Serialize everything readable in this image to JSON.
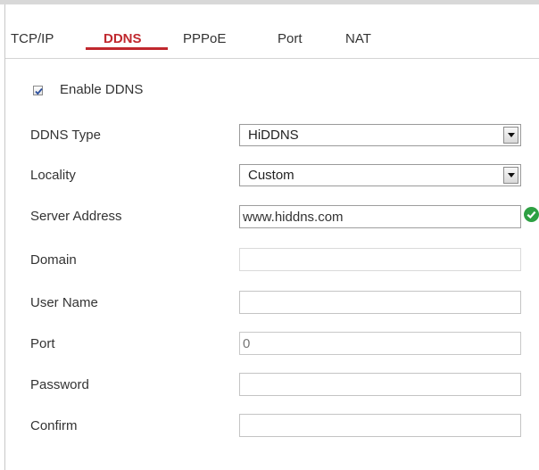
{
  "tabs": [
    {
      "label": "TCP/IP",
      "active": false
    },
    {
      "label": "DDNS",
      "active": true
    },
    {
      "label": "PPPoE",
      "active": false
    },
    {
      "label": "Port",
      "active": false
    },
    {
      "label": "NAT",
      "active": false
    }
  ],
  "enable_ddns": {
    "label": "Enable DDNS",
    "checked": true
  },
  "fields": {
    "ddns_type": {
      "label": "DDNS Type",
      "value": "HiDDNS"
    },
    "locality": {
      "label": "Locality",
      "value": "Custom"
    },
    "server_address": {
      "label": "Server Address",
      "value": "www.hiddns.com",
      "status_icon": "check-circle-icon"
    },
    "domain": {
      "label": "Domain",
      "value": ""
    },
    "user_name": {
      "label": "User Name",
      "value": ""
    },
    "port": {
      "label": "Port",
      "placeholder": "0"
    },
    "password": {
      "label": "Password",
      "value": ""
    },
    "confirm": {
      "label": "Confirm",
      "value": ""
    }
  },
  "colors": {
    "accent": "#c0282e",
    "valid": "#2ea043"
  }
}
